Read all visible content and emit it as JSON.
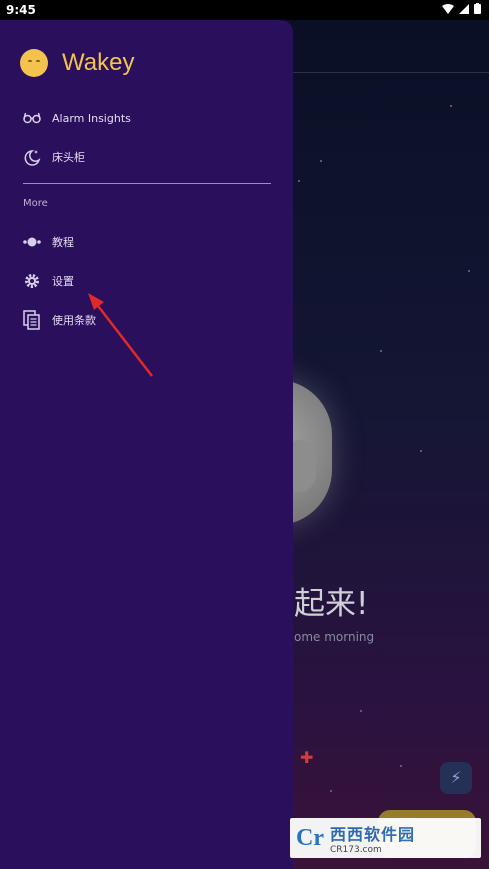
{
  "status_bar": {
    "time": "9:45"
  },
  "drawer": {
    "app_name": "Wakey",
    "items": [
      {
        "label": "Alarm Insights",
        "icon": "glasses-icon"
      },
      {
        "label": "床头柜",
        "icon": "moon-stars-icon"
      }
    ],
    "section_title": "More",
    "more_items": [
      {
        "label": "教程",
        "icon": "tutorial-icon"
      },
      {
        "label": "设置",
        "icon": "gear-icon"
      },
      {
        "label": "使用条款",
        "icon": "document-copy-icon"
      }
    ]
  },
  "background": {
    "title": "起来!",
    "subtitle": "ome morning"
  },
  "watermark": {
    "logo": "Cr",
    "cn_text": "西西软件园",
    "url": "CR173.com"
  },
  "colors": {
    "drawer": "#2a0f5c",
    "brand": "#f3c34d",
    "arrow": "#e02a2a"
  }
}
